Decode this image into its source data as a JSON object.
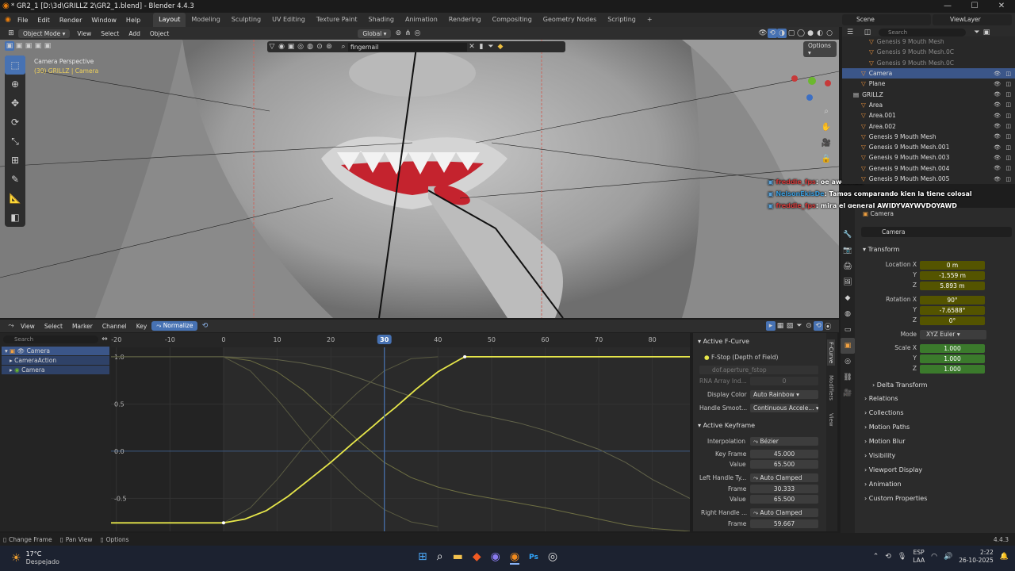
{
  "window": {
    "title": "* GR2_1 [D:\\3d\\GRILLZ 2\\GR2_1.blend] - Blender 4.4.3",
    "controls": [
      "—",
      "☐",
      "✕"
    ]
  },
  "menu": {
    "items": [
      "File",
      "Edit",
      "Render",
      "Window",
      "Help"
    ],
    "workspaces": [
      "Layout",
      "Modeling",
      "Sculpting",
      "UV Editing",
      "Texture Paint",
      "Shading",
      "Animation",
      "Rendering",
      "Compositing",
      "Geometry Nodes",
      "Scripting"
    ],
    "active_workspace": "Layout",
    "add_tab": "+",
    "scene": "Scene",
    "view_layer": "ViewLayer"
  },
  "viewport_header": {
    "mode": "Object Mode",
    "menus": [
      "View",
      "Select",
      "Add",
      "Object"
    ],
    "transform": "Global",
    "search_value": "fingernail",
    "options": "Options"
  },
  "viewport": {
    "view_name": "Camera Perspective",
    "subtitle": "(30) GRILLZ | Camera"
  },
  "chat": [
    {
      "user": "freddie_fps",
      "text": ": oe aweonao",
      "user_color": "#d33b3b"
    },
    {
      "user": "NelsonEkisDe",
      "text": ": Tamos comparando kien la tiene colosal",
      "user_color": "#3b9bd9"
    },
    {
      "user": "freddie_fps",
      "text": ": mira el general AWIDYVAYWVDOYAWD",
      "user_color": "#d33b3b"
    }
  ],
  "outliner": {
    "search_placeholder": "Search",
    "rows": [
      {
        "label": "Genesis 9 Mouth Mesh",
        "indent": 2,
        "dim": true
      },
      {
        "label": "Genesis 9 Mouth Mesh.0C",
        "indent": 2,
        "dim": true
      },
      {
        "label": "Genesis 9 Mouth Mesh.0C",
        "indent": 2,
        "dim": true
      },
      {
        "label": "Camera",
        "indent": 1,
        "selected": true
      },
      {
        "label": "Plane",
        "indent": 1
      },
      {
        "label": "GRILLZ",
        "indent": 0
      },
      {
        "label": "Area",
        "indent": 1
      },
      {
        "label": "Area.001",
        "indent": 1
      },
      {
        "label": "Area.002",
        "indent": 1
      },
      {
        "label": "Genesis 9 Mouth Mesh",
        "indent": 1
      },
      {
        "label": "Genesis 9 Mouth Mesh.001",
        "indent": 1
      },
      {
        "label": "Genesis 9 Mouth Mesh.003",
        "indent": 1
      },
      {
        "label": "Genesis 9 Mouth Mesh.004",
        "indent": 1
      },
      {
        "label": "Genesis 9 Mouth Mesh.005",
        "indent": 1
      }
    ]
  },
  "properties": {
    "object_breadcrumb": "Camera",
    "object_name": "Camera",
    "transform_title": "Transform",
    "location": {
      "label": "Location X",
      "x": "0 m",
      "y": "-1.559 m",
      "z": "5.893 m"
    },
    "rotation": {
      "label": "Rotation X",
      "x": "90°",
      "y": "-7.6588°",
      "z": "0°"
    },
    "axis": {
      "y": "Y",
      "z": "Z"
    },
    "mode_label": "Mode",
    "mode_value": "XYZ Euler",
    "scale": {
      "label": "Scale X",
      "x": "1.000",
      "y": "1.000",
      "z": "1.000"
    },
    "delta": "Delta Transform",
    "sections": [
      "Relations",
      "Collections",
      "Motion Paths",
      "Motion Blur",
      "Visibility",
      "Viewport Display",
      "Animation",
      "Custom Properties"
    ]
  },
  "graph_header": {
    "menus": [
      "View",
      "Select",
      "Marker",
      "Channel",
      "Key"
    ],
    "normalize": "Normalize"
  },
  "channels": {
    "search_placeholder": "Search",
    "items": [
      "Camera",
      "CameraAction",
      "Camera"
    ]
  },
  "chart_data": {
    "type": "line",
    "title": "",
    "x_ticks": [
      -20,
      -10,
      0,
      10,
      20,
      30,
      40,
      50,
      60,
      70,
      80
    ],
    "y_ticks": [
      1.0,
      0.5,
      0.0,
      -0.5
    ],
    "y_tick_labels": [
      "1.0",
      "0.5",
      "0.0",
      "-0.5"
    ],
    "xlim": [
      -21,
      87
    ],
    "ylim": [
      -0.85,
      1.1
    ],
    "current_frame": 30,
    "series": [
      {
        "key": "main",
        "color": "#e6e64a",
        "x": [
          -21,
          0,
          4,
          8,
          12,
          16,
          20,
          24,
          28,
          30,
          32,
          36,
          40,
          44,
          45,
          87
        ],
        "y": [
          -0.76,
          -0.76,
          -0.72,
          -0.63,
          -0.48,
          -0.3,
          -0.12,
          0.08,
          0.27,
          0.37,
          0.46,
          0.66,
          0.84,
          0.97,
          1.0,
          1.0
        ]
      },
      {
        "key": "faint1",
        "color": "#6f7044",
        "x": [
          -21,
          0,
          5,
          10,
          15,
          20,
          25,
          30,
          35,
          40,
          45,
          50,
          55,
          60,
          65,
          70,
          75,
          80,
          87
        ],
        "y": [
          1.0,
          1.0,
          0.96,
          0.84,
          0.64,
          0.38,
          0.12,
          -0.12,
          -0.28,
          -0.38,
          -0.45,
          -0.5,
          -0.55,
          -0.6,
          -0.66,
          -0.72,
          -0.78,
          -0.82,
          -0.85
        ]
      },
      {
        "key": "faint2",
        "color": "#62634a",
        "x": [
          -21,
          0,
          5,
          10,
          15,
          20,
          25,
          30,
          35,
          40,
          45,
          50,
          55,
          60,
          65,
          70,
          75,
          80,
          87
        ],
        "y": [
          1.0,
          1.0,
          0.99,
          0.97,
          0.93,
          0.87,
          0.78,
          0.68,
          0.58,
          0.5,
          0.42,
          0.36,
          0.3,
          0.22,
          0.12,
          0.02,
          -0.12,
          -0.3,
          -0.5
        ]
      },
      {
        "key": "faint3",
        "color": "#5a5b42",
        "x": [
          -21,
          0,
          5,
          10,
          15,
          20,
          25,
          30,
          35,
          40
        ],
        "y": [
          -0.76,
          -0.76,
          -0.6,
          -0.3,
          0.05,
          0.35,
          0.62,
          0.85,
          0.98,
          1.0
        ]
      },
      {
        "key": "faint4",
        "color": "#5a5b42",
        "x": [
          -21,
          0,
          5,
          10,
          15,
          20,
          25,
          30,
          35,
          40
        ],
        "y": [
          1.0,
          1.0,
          0.85,
          0.55,
          0.2,
          -0.12,
          -0.4,
          -0.62,
          -0.75,
          -0.8
        ]
      }
    ]
  },
  "fcurve_panel": {
    "title": "Active F-Curve",
    "name": "F-Stop (Depth of Field)",
    "path": "dof.aperture_fstop",
    "rna_label": "RNA Array Ind...",
    "rna_value": "0",
    "display_color_label": "Display Color",
    "display_color": "Auto Rainbow",
    "handle_smooth_label": "Handle Smoot...",
    "handle_smooth": "Continuous Accele..."
  },
  "keyframe_panel": {
    "title": "Active Keyframe",
    "interp_label": "Interpolation",
    "interp": "Bézier",
    "key_frame_label": "Key Frame",
    "key_frame": "45.000",
    "value_label": "Value",
    "value": "65.500",
    "left_handle_label": "Left Handle Ty...",
    "left_handle": "Auto Clamped",
    "left_frame_label": "Frame",
    "left_frame": "30.333",
    "left_value_label": "Value",
    "left_value": "65.500",
    "right_handle_label": "Right Handle ...",
    "right_handle": "Auto Clamped",
    "right_frame_label": "Frame",
    "right_frame": "59.667"
  },
  "side_tabs": [
    "F-Curve",
    "Modifiers",
    "View"
  ],
  "statusbar": {
    "items": [
      "Change Frame",
      "Pan View",
      "Options"
    ],
    "version": "4.4.3"
  },
  "taskbar": {
    "weather_temp": "17°C",
    "weather_desc": "Despejado",
    "lang": "ESP",
    "lang2": "LAA",
    "time": "2:22",
    "date": "26-10-2025"
  },
  "colors": {
    "accent": "#4772b3",
    "selected_row": "#3b5689",
    "keyed_field": "#545400",
    "scale_field": "#3b7a2c",
    "curve": "#e6e64a"
  }
}
